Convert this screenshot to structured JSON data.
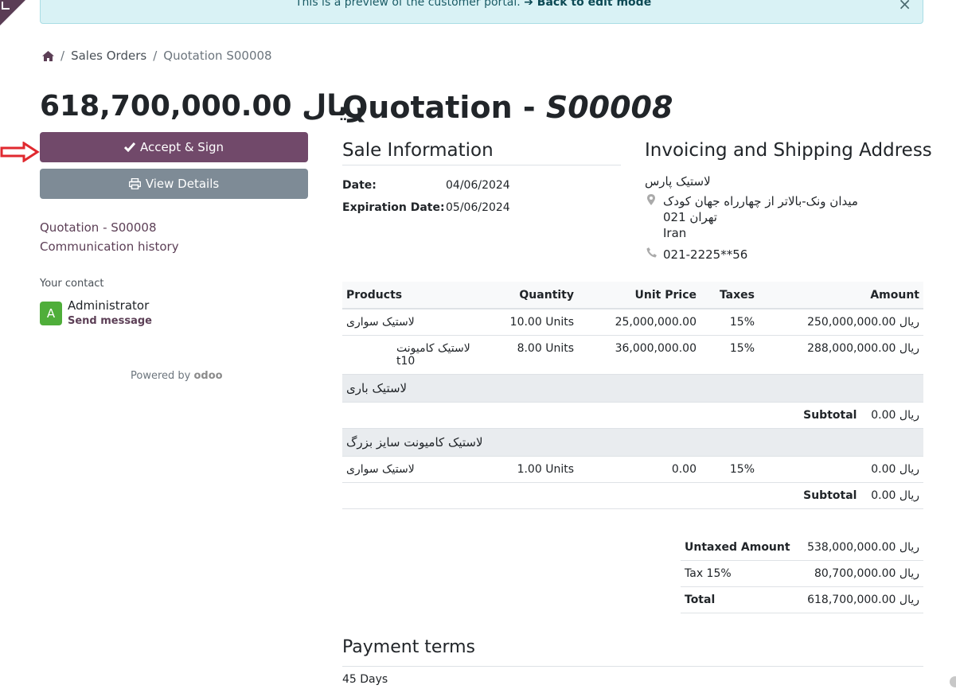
{
  "banner": {
    "text": "This is a preview of the customer portal.",
    "link": "➔ Back to edit mode",
    "close": "×"
  },
  "breadcrumb": {
    "sep": "/",
    "items": [
      "Sales Orders",
      "Quotation S00008"
    ]
  },
  "sidebar": {
    "amount": "618,700,000.00 ریال",
    "accept_label": "Accept & Sign",
    "details_label": "View Details",
    "links": [
      "Quotation - S00008",
      "Communication history"
    ],
    "contact_title": "Your contact",
    "avatar_letter": "A",
    "contact_name": "Administrator",
    "send_message": "Send message",
    "powered_by": "Powered by",
    "odoo": "odoo"
  },
  "document": {
    "title_prefix": "Quotation - ",
    "title_number": "S00008",
    "sale_info_title": "Sale Information",
    "date_label": "Date:",
    "date_value": "04/06/2024",
    "expiration_label": "Expiration Date:",
    "expiration_value": "05/06/2024",
    "address_title": "Invoicing and Shipping Address",
    "address": {
      "name": "لاستیک پارس",
      "street": "میدان ونک-بالاتر از چهارراه جهان کودک",
      "city": "تهران 021",
      "country": "Iran",
      "phone": "021-2225**56"
    }
  },
  "table": {
    "headers": [
      "Products",
      "Quantity",
      "Unit Price",
      "Taxes",
      "Amount"
    ],
    "rows": [
      {
        "product": "لاستیک سواری",
        "qty": "10.00 Units",
        "price": "25,000,000.00",
        "tax": "15%",
        "amount": "250,000,000.00 ریال"
      },
      {
        "product": "لاستیک کامیونت t10",
        "qty": "8.00 Units",
        "price": "36,000,000.00",
        "tax": "15%",
        "amount": "288,000,000.00 ریال"
      }
    ],
    "section1": "لاستیک باری",
    "subtotal_label": "Subtotal",
    "subtotal1": "0.00 ریال",
    "section2": "لاستیک کامیونت سایز بزرگ",
    "row3": {
      "product": "لاستیک سواری",
      "qty": "1.00 Units",
      "price": "0.00",
      "tax": "15%",
      "amount": "0.00 ریال"
    },
    "subtotal2": "0.00 ریال"
  },
  "totals": {
    "untaxed_label": "Untaxed Amount",
    "untaxed_value": "538,000,000.00 ریال",
    "tax_label": "Tax 15%",
    "tax_value": "80,700,000.00 ریال",
    "total_label": "Total",
    "total_value": "618,700,000.00 ریال"
  },
  "payment": {
    "title": "Payment terms",
    "value": "45 Days"
  },
  "colors": {
    "accent": "#71496a",
    "secondary_button": "#7e8b96",
    "arrow": "#e0292f",
    "banner_bg": "#d9f2f5"
  }
}
